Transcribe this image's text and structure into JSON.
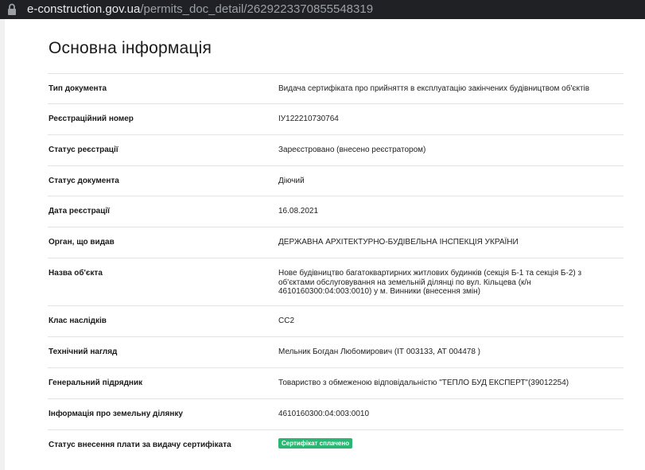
{
  "browser": {
    "url_host": "e-construction.gov.ua",
    "url_path": "/permits_doc_detail/2629223370855548319"
  },
  "page": {
    "title": "Основна інформація"
  },
  "rows": [
    {
      "label": "Тип документа",
      "value": "Видача сертифіката про прийняття в експлуатацію закінчених будівництвом об'єктів"
    },
    {
      "label": "Реєстраційний номер",
      "value": "ІУ122210730764"
    },
    {
      "label": "Статус реєстрації",
      "value": "Зареєстровано (внесено реєстратором)"
    },
    {
      "label": "Статус документа",
      "value": "Діючий"
    },
    {
      "label": "Дата реєстрації",
      "value": "16.08.2021"
    },
    {
      "label": "Орган, що видав",
      "value": "ДЕРЖАВНА АРХІТЕКТУРНО-БУДІВЕЛЬНА ІНСПЕКЦІЯ УКРАЇНИ"
    },
    {
      "label": "Назва об'єкта",
      "value": "Нове будівництво багатоквартирних житлових будинків (секція Б-1 та секція Б-2) з об'єктами обслуговування на земельній ділянці по вул. Кільцева (к/н 4610160300:04:003:0010) у м. Винники (внесення змін)"
    },
    {
      "label": "Клас наслідків",
      "value": "СС2"
    },
    {
      "label": "Технічний нагляд",
      "value": "Мельник Богдан Любомирович (ІТ 003133, АТ 004478 )"
    },
    {
      "label": "Генеральний підрядник",
      "value": "Товариство з обмеженою відповідальністю \"ТЕПЛО БУД ЕКСПЕРТ\"(39012254)"
    },
    {
      "label": "Інформація про земельну ділянку",
      "value": "4610160300:04:003:0010"
    },
    {
      "label": "Статус внесення плати за видачу сертифіката",
      "badge": "Сертифікат сплачено"
    }
  ],
  "colors": {
    "badge": "#2bb673",
    "address_bar": "#202124"
  },
  "icons": {
    "address_bar": "lock-icon"
  }
}
